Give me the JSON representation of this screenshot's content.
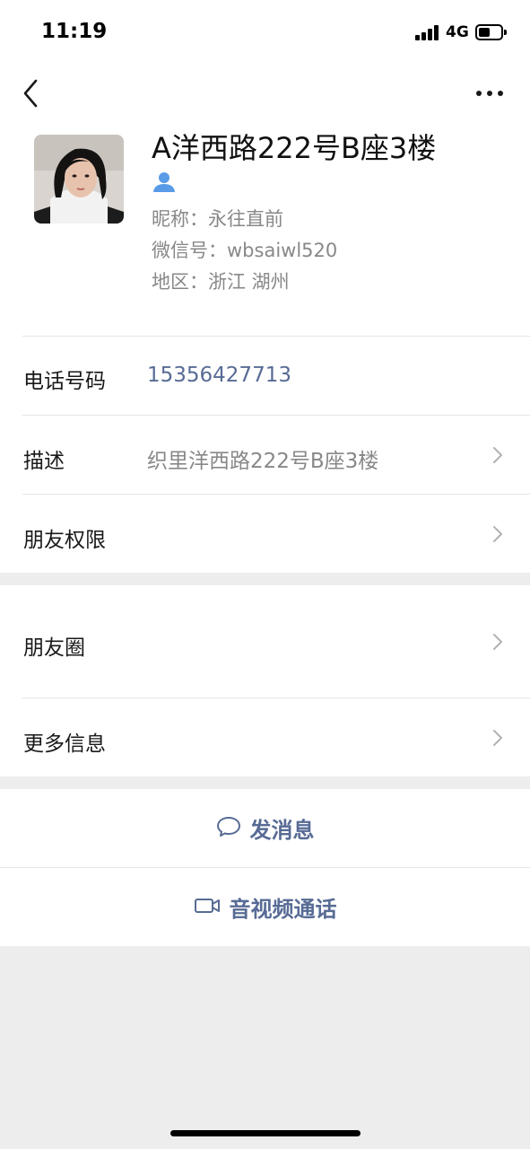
{
  "status_bar": {
    "time": "11:19",
    "network": "4G"
  },
  "header": {
    "back_icon": "chevron-left-icon",
    "more_icon": "ellipsis-icon"
  },
  "profile": {
    "name": "A洋西路222号B座3楼",
    "friend_icon": "person-icon",
    "nickname": "昵称：永往直前",
    "wechat_id": "微信号：wbsaiwl520",
    "region": "地区：浙江 湖州"
  },
  "rows": {
    "phone": {
      "label": "电话号码",
      "value": "15356427713"
    },
    "description": {
      "label": "描述",
      "value": "织里洋西路222号B座3楼"
    },
    "permissions": {
      "label": "朋友权限"
    },
    "moments": {
      "label": "朋友圈"
    },
    "more_info": {
      "label": "更多信息"
    }
  },
  "actions": {
    "send_message": {
      "label": "发消息",
      "icon": "chat-bubble-icon"
    },
    "video_call": {
      "label": "音视频通话",
      "icon": "video-camera-icon"
    }
  },
  "colors": {
    "link_blue": "#576b95",
    "secondary_text": "#888888",
    "background": "#ededed",
    "friend_icon": "#5a9be8"
  }
}
